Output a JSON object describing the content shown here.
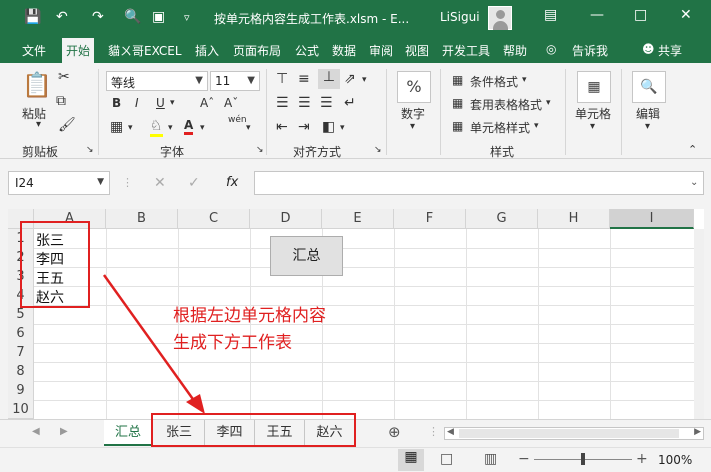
{
  "titlebar": {
    "file_title": "按单元格内容生成工作表.xlsm  -  E...",
    "user": "LiSigui"
  },
  "ribbon_tabs": [
    "文件",
    "开始",
    "貓ㄨ哥EXCEL",
    "插入",
    "页面布局",
    "公式",
    "数据",
    "审阅",
    "视图",
    "开发工具",
    "帮助",
    "告诉我",
    "共享"
  ],
  "ribbon": {
    "clipboard": {
      "paste": "粘贴",
      "label": "剪贴板"
    },
    "font": {
      "name": "等线",
      "size": "11",
      "label": "字体",
      "phonetic": "wén"
    },
    "alignment": {
      "label": "对齐方式"
    },
    "number": {
      "label": "数字",
      "icon": "%"
    },
    "styles": {
      "cond": "条件格式",
      "table": "套用表格格式",
      "cell": "单元格样式",
      "label": "样式"
    },
    "cells": {
      "label": "单元格"
    },
    "editing": {
      "label": "编辑"
    }
  },
  "formula_bar": {
    "name_box": "I24",
    "fx": "fx"
  },
  "columns": [
    "A",
    "B",
    "C",
    "D",
    "E",
    "F",
    "G",
    "H",
    "I"
  ],
  "rows": [
    "1",
    "2",
    "3",
    "4",
    "5",
    "6",
    "7",
    "8",
    "9",
    "10"
  ],
  "cells_a": [
    "张三",
    "李四",
    "王五",
    "赵六"
  ],
  "sum_button": "汇总",
  "annotation": [
    "根据左边单元格内容",
    "生成下方工作表"
  ],
  "sheets": [
    "汇总",
    "张三",
    "李四",
    "王五",
    "赵六"
  ],
  "zoom": "100%"
}
